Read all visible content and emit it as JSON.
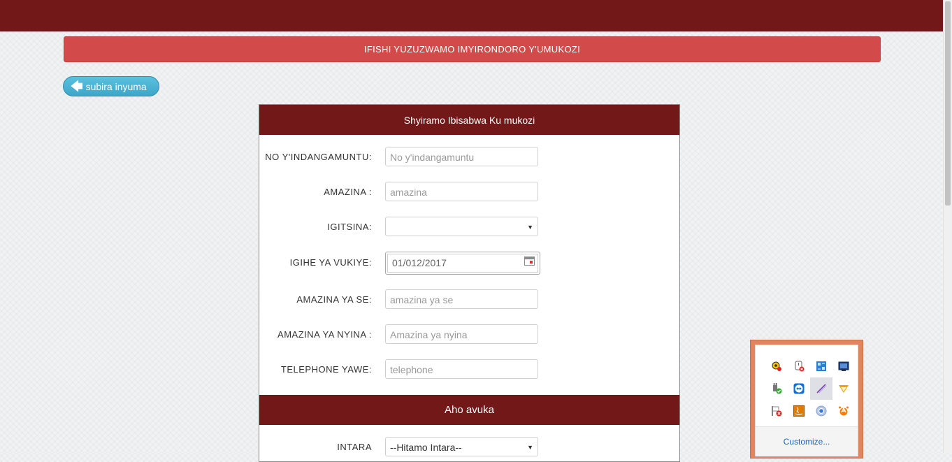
{
  "header": {
    "banner_title": "IFISHI YUZUZWAMO IMYIRONDORO Y'UMUKOZI"
  },
  "back_button": {
    "label": "subira inyuma",
    "icon": "arrow-left-icon"
  },
  "form": {
    "panel_title": "Shyiramo Ibisabwa Ku mukozi",
    "fields": [
      {
        "label": "NO Y'INDANGAMUNTU:",
        "placeholder": "No y'indangamuntu"
      },
      {
        "label": "AMAZINA :",
        "placeholder": "amazina"
      },
      {
        "label": "IGITSINA:",
        "value": ""
      },
      {
        "label": "IGIHE YA VUKIYE:",
        "value": "01/012/2017"
      },
      {
        "label": "AMAZINA YA SE:",
        "placeholder": "amazina ya se"
      },
      {
        "label": "AMAZINA YA NYINA :",
        "placeholder": "Amazina ya nyina"
      },
      {
        "label": "TELEPHONE YAWE:",
        "placeholder": "telephone"
      }
    ],
    "section_title": "Aho avuka",
    "province": {
      "label": "INTARA",
      "value": "--Hitamo Intara--"
    }
  },
  "tray": {
    "icons": [
      "security-key-icon",
      "usb-disconnected-icon",
      "network-monitor-icon",
      "display-icon",
      "power-plugged-icon",
      "teamviewer-icon",
      "pen-tablet-icon",
      "vlc-icon",
      "flag-error-icon",
      "java-icon",
      "chrome-icon",
      "avast-icon"
    ],
    "customize_label": "Customize..."
  },
  "colors": {
    "brand": "#731818",
    "banner": "#d24a4a",
    "back_button": "#3da6c8",
    "tray_border": "#e08562"
  }
}
